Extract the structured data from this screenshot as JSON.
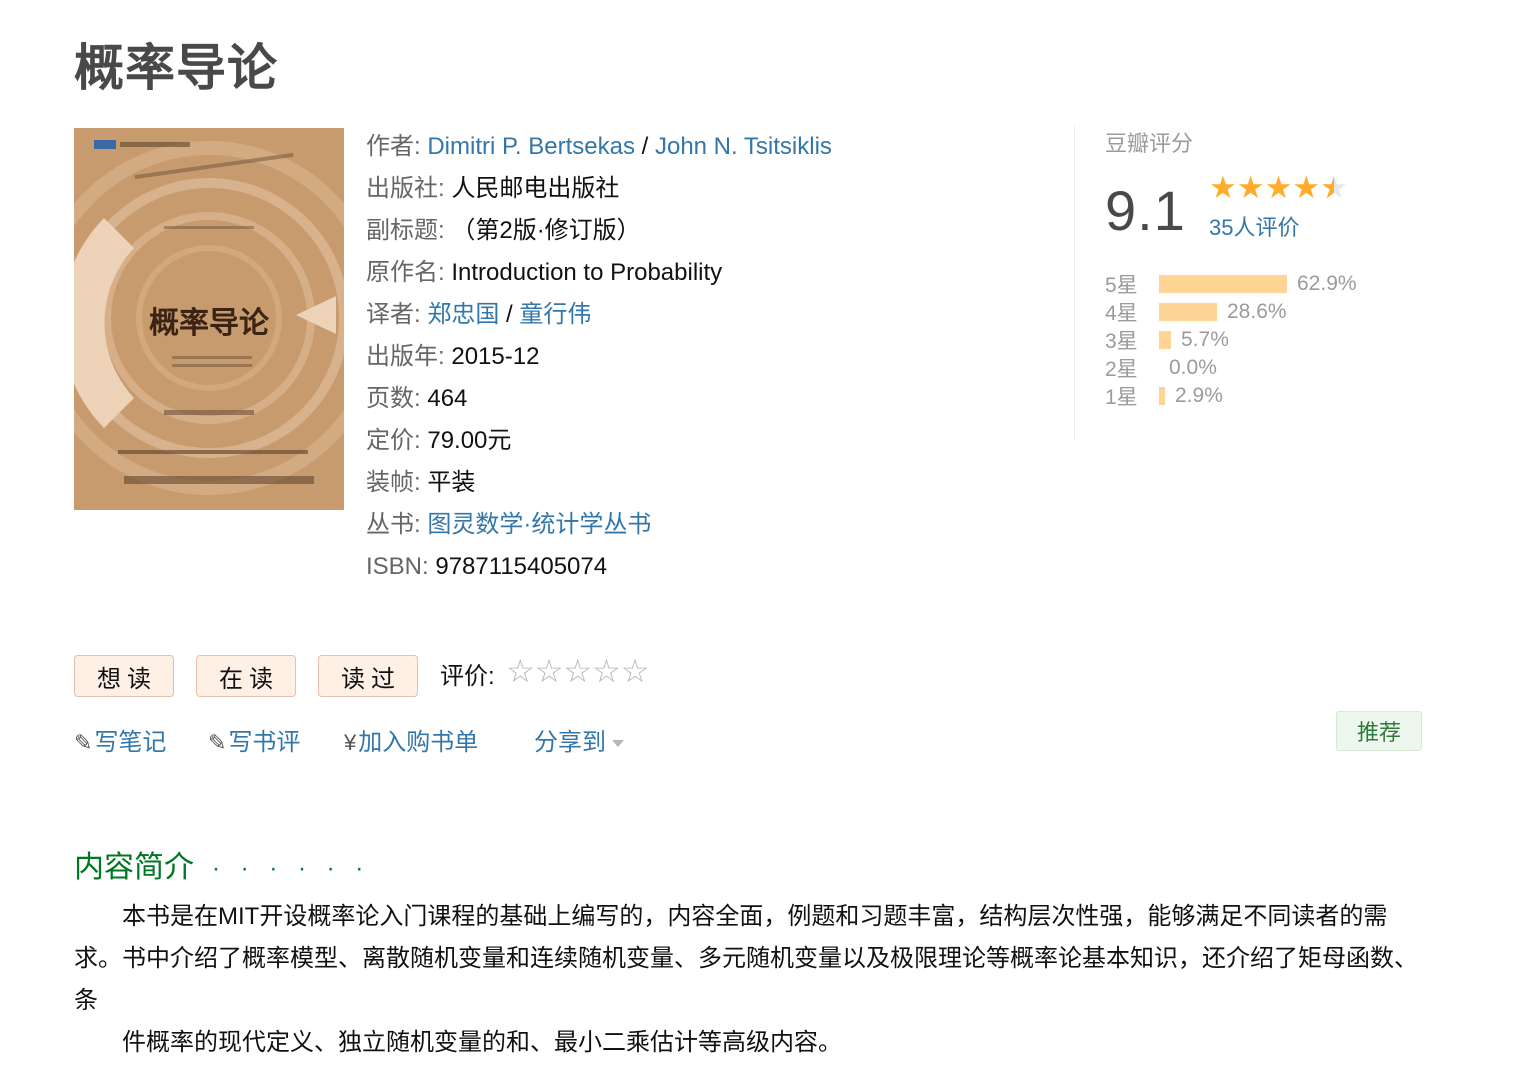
{
  "book": {
    "title": "概率导论",
    "cover": {
      "series_tag": "图灵数学·统计学丛书",
      "title": "概率导论",
      "edition": "（第2版·修订版）"
    },
    "info": [
      {
        "label": "作者",
        "values": [
          "Dimitri P. Bertsekas",
          "John N. Tsitsiklis"
        ],
        "link": true
      },
      {
        "label": "出版社",
        "value": "人民邮电出版社"
      },
      {
        "label": "副标题",
        "value": "（第2版·修订版）"
      },
      {
        "label": "原作名",
        "value": "Introduction to Probability"
      },
      {
        "label": "译者",
        "values": [
          "郑忠国",
          "童行伟"
        ],
        "link": true
      },
      {
        "label": "出版年",
        "value": "2015-12"
      },
      {
        "label": "页数",
        "value": "464"
      },
      {
        "label": "定价",
        "value": "79.00元"
      },
      {
        "label": "装帧",
        "value": "平装"
      },
      {
        "label": "丛书",
        "value": "图灵数学·统计学丛书",
        "link": true
      },
      {
        "label": "ISBN",
        "value": "9787115405074"
      }
    ]
  },
  "rating": {
    "title": "豆瓣评分",
    "score": "9.1",
    "stars": 4.5,
    "votes": "35人评价",
    "distribution": [
      {
        "label": "5星",
        "percent": "62.9%",
        "value": 62.9
      },
      {
        "label": "4星",
        "percent": "28.6%",
        "value": 28.6
      },
      {
        "label": "3星",
        "percent": "5.7%",
        "value": 5.7
      },
      {
        "label": "2星",
        "percent": "0.0%",
        "value": 0.0
      },
      {
        "label": "1星",
        "percent": "2.9%",
        "value": 2.9
      }
    ]
  },
  "buttons": {
    "want": "想读",
    "reading": "在读",
    "read": "读过",
    "rate_label": "评价:"
  },
  "actions": {
    "note": "写笔记",
    "review": "写书评",
    "cart": "加入购书单",
    "share": "分享到",
    "recommend": "推荐"
  },
  "intro": {
    "heading": "内容简介",
    "dots": "· · · · · ·",
    "paragraphs": [
      "本书是在MIT开设概率论入门课程的基础上编写的，内容全面，例题和习题丰富，结构层次性强，能够满足不同读者的需求。书中介绍了概率模型、离散随机变量和连续随机变量、多元随机变量以及极限理论等概率论基本知识，还介绍了矩母函数、条",
      "件概率的现代定义、独立随机变量的和、最小二乘估计等高级内容。"
    ]
  },
  "icons": {
    "pencil": "pencil-icon",
    "yen": "yen-icon"
  },
  "colors": {
    "link": "#3377aa",
    "star": "#ffac2d",
    "bar": "#ffd596",
    "section_green": "#007722",
    "button_bg": "#fff0e5"
  }
}
